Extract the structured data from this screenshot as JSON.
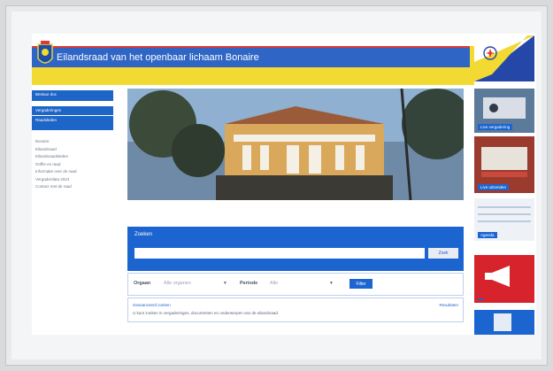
{
  "header": {
    "title": "Eilandsraad van het openbaar lichaam Bonaire"
  },
  "sidebar": {
    "items": [
      {
        "label": "Bestuur doc"
      },
      {
        "label": "Vergaderingen"
      },
      {
        "label": "Raadsleden"
      }
    ],
    "links": [
      "Bonaire",
      "Eilandsraad",
      "Eilandsraadsleden",
      "Griffie en raad",
      "Informatie over de raad",
      "Vergaderdata 2024",
      "",
      "Contact met de raad"
    ]
  },
  "search": {
    "label": "Zoeken",
    "placeholder": "",
    "button_label": "Zoek"
  },
  "filters": {
    "orgaan_label": "Orgaan",
    "orgaan_value": "Alle organen",
    "periode_label": "Periode",
    "periode_value": "Alle",
    "filter_button": "Filter"
  },
  "info": {
    "left_link": "Geavanceerd zoeken",
    "right_link": "Resultaten",
    "note": "U kunt zoeken in vergaderingen, documenten en onderwerpen van de eilandsraad."
  },
  "right_tiles": [
    {
      "label": "Live vergadering"
    },
    {
      "label": "Live uitzenden"
    },
    {
      "label": "Agenda"
    },
    {
      "label": ""
    },
    {
      "label": ""
    }
  ],
  "colors": {
    "accent_blue": "#1c64d0",
    "flag_yellow": "#f2da32",
    "accent_red": "#e03b2e"
  }
}
